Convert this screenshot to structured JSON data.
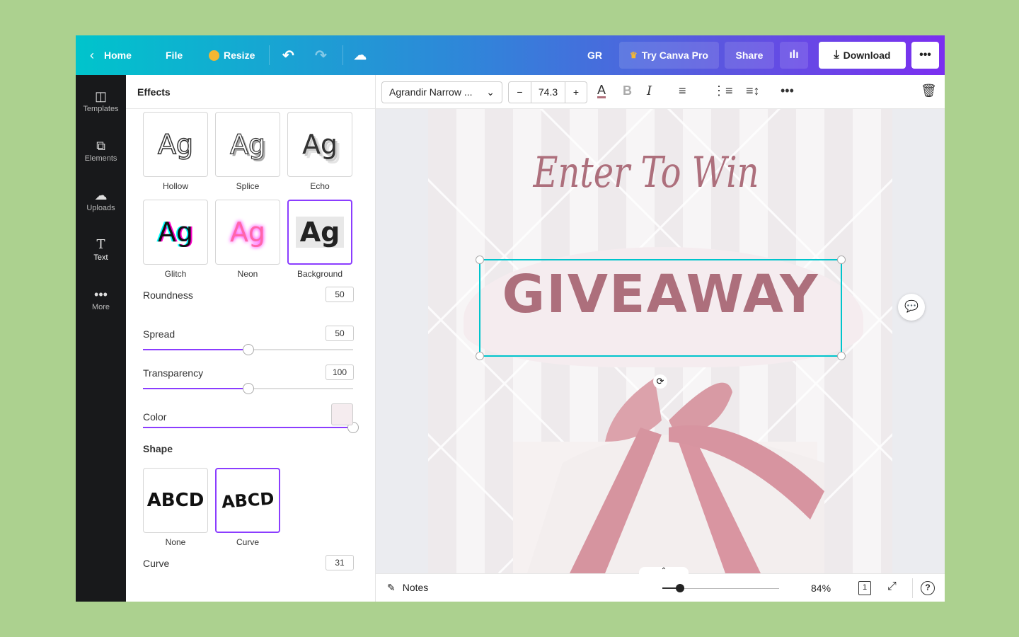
{
  "topbar": {
    "home": "Home",
    "file": "File",
    "resize": "Resize",
    "user_initials": "GR",
    "try_pro": "Try Canva Pro",
    "share": "Share",
    "download": "Download"
  },
  "sidebar": {
    "items": [
      {
        "label": "Templates",
        "icon": "templates-icon"
      },
      {
        "label": "Elements",
        "icon": "elements-icon"
      },
      {
        "label": "Uploads",
        "icon": "uploads-icon"
      },
      {
        "label": "Text",
        "icon": "text-icon"
      },
      {
        "label": "More",
        "icon": "more-icon"
      }
    ],
    "active": "Text"
  },
  "panel": {
    "title": "Effects",
    "effects": [
      {
        "label": "Hollow",
        "sample": "Ag"
      },
      {
        "label": "Splice",
        "sample": "Ag"
      },
      {
        "label": "Echo",
        "sample": "Ag"
      },
      {
        "label": "Glitch",
        "sample": "Ag"
      },
      {
        "label": "Neon",
        "sample": "Ag"
      },
      {
        "label": "Background",
        "sample": "Ag",
        "selected": true
      }
    ],
    "roundness": {
      "label": "Roundness",
      "value": "50"
    },
    "spread": {
      "label": "Spread",
      "value": "50"
    },
    "transparency": {
      "label": "Transparency",
      "value": "100"
    },
    "color": {
      "label": "Color",
      "value": "#f5ecef"
    },
    "shape_title": "Shape",
    "shapes": [
      {
        "label": "None",
        "sample": "ABCD"
      },
      {
        "label": "Curve",
        "sample": "ABCD",
        "selected": true
      }
    ],
    "curve": {
      "label": "Curve",
      "value": "31"
    }
  },
  "toolbar": {
    "font": "Agrandir Narrow ...",
    "font_size": "74.3",
    "minus": "−",
    "plus": "+",
    "text_color": "#b06f7a"
  },
  "design": {
    "heading": "Enter To Win",
    "main_text": "GIVEAWAY",
    "text_color": "#ad6f7c"
  },
  "bottombar": {
    "notes": "Notes",
    "zoom": "84%",
    "page_number": "1",
    "zoom_slider_percent": 84
  },
  "colors": {
    "accent": "#8b3dff",
    "selection": "#00c4cc"
  }
}
